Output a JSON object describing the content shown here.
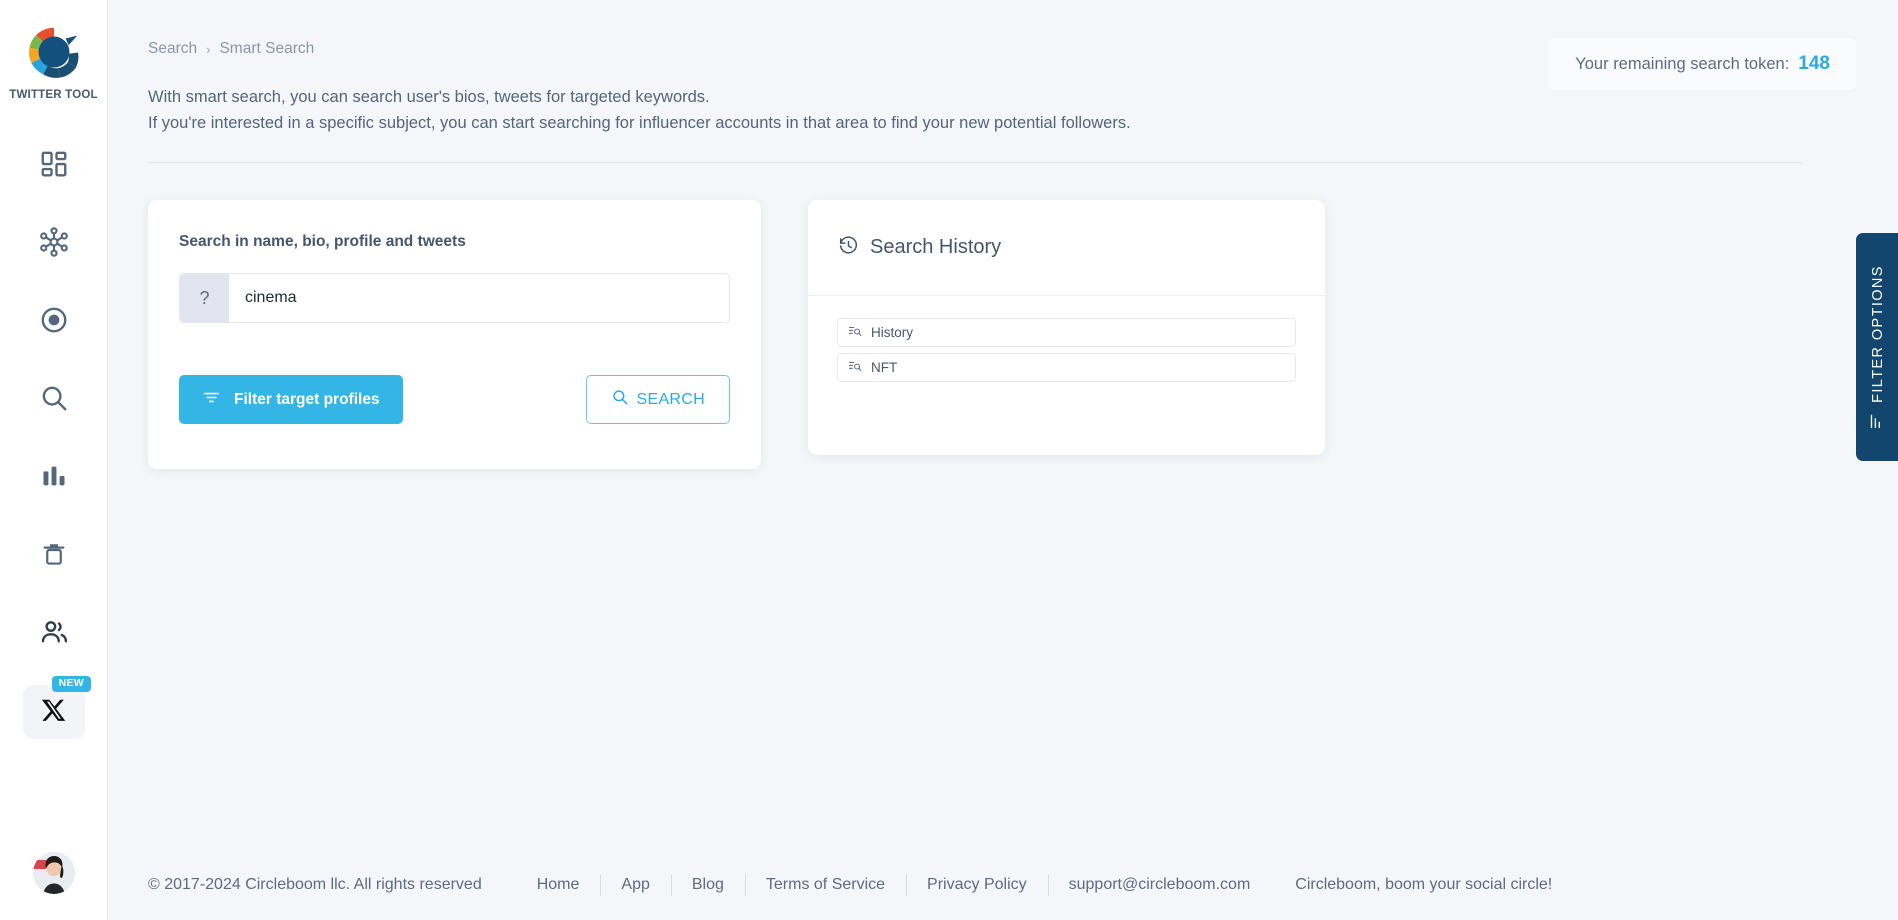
{
  "sidebar": {
    "logo_text": "TWITTER TOOL",
    "logo_icon": "circleboom-logo-icon",
    "items": [
      {
        "name": "dashboard",
        "icon": "grid-dashboard-icon"
      },
      {
        "name": "network",
        "icon": "network-nodes-icon"
      },
      {
        "name": "target",
        "icon": "target-circle-icon"
      },
      {
        "name": "search",
        "icon": "search-magnifier-icon"
      },
      {
        "name": "analytics",
        "icon": "bar-chart-icon"
      },
      {
        "name": "delete",
        "icon": "trash-bin-icon"
      },
      {
        "name": "users",
        "icon": "users-group-icon"
      }
    ],
    "x_item": {
      "icon": "x-twitter-icon",
      "badge": "NEW"
    },
    "avatar": "user-avatar"
  },
  "header": {
    "breadcrumb": {
      "parent": "Search",
      "separator": "›",
      "current": "Smart Search"
    },
    "description_line_1": "With smart search, you can search user's bios, tweets for targeted keywords.",
    "description_line_2": "If you're interested in a specific subject, you can start searching for influencer accounts in that area to find your new potential followers.",
    "token_label": "Your remaining search token:",
    "token_value": "148",
    "token_color": "#2aaae0"
  },
  "search_card": {
    "label": "Search in name, bio, profile and tweets",
    "prefix_icon": "question-mark-icon",
    "prefix_symbol": "?",
    "input_value": "cinema",
    "input_placeholder": "",
    "filter_button": {
      "label": "Filter target profiles",
      "icon": "filter-lines-icon",
      "color": "#33b5e5"
    },
    "search_button": {
      "label": "SEARCH",
      "icon": "search-magnifier-icon",
      "color": "#2aaae0"
    }
  },
  "history_card": {
    "title": "Search History",
    "title_icon": "clock-rewind-icon",
    "items": [
      {
        "label": "History",
        "icon": "search-list-icon"
      },
      {
        "label": "NFT",
        "icon": "search-list-icon"
      }
    ]
  },
  "filter_options_tab": {
    "label": "FILTER OPTIONS",
    "icon": "filter-sliders-icon",
    "color": "#13466e"
  },
  "footer": {
    "copyright": "© 2017-2024 Circleboom llc. All rights reserved",
    "links": [
      "Home",
      "App",
      "Blog",
      "Terms of Service",
      "Privacy Policy",
      "support@circleboom.com"
    ],
    "tagline": "Circleboom, boom your social circle!"
  }
}
